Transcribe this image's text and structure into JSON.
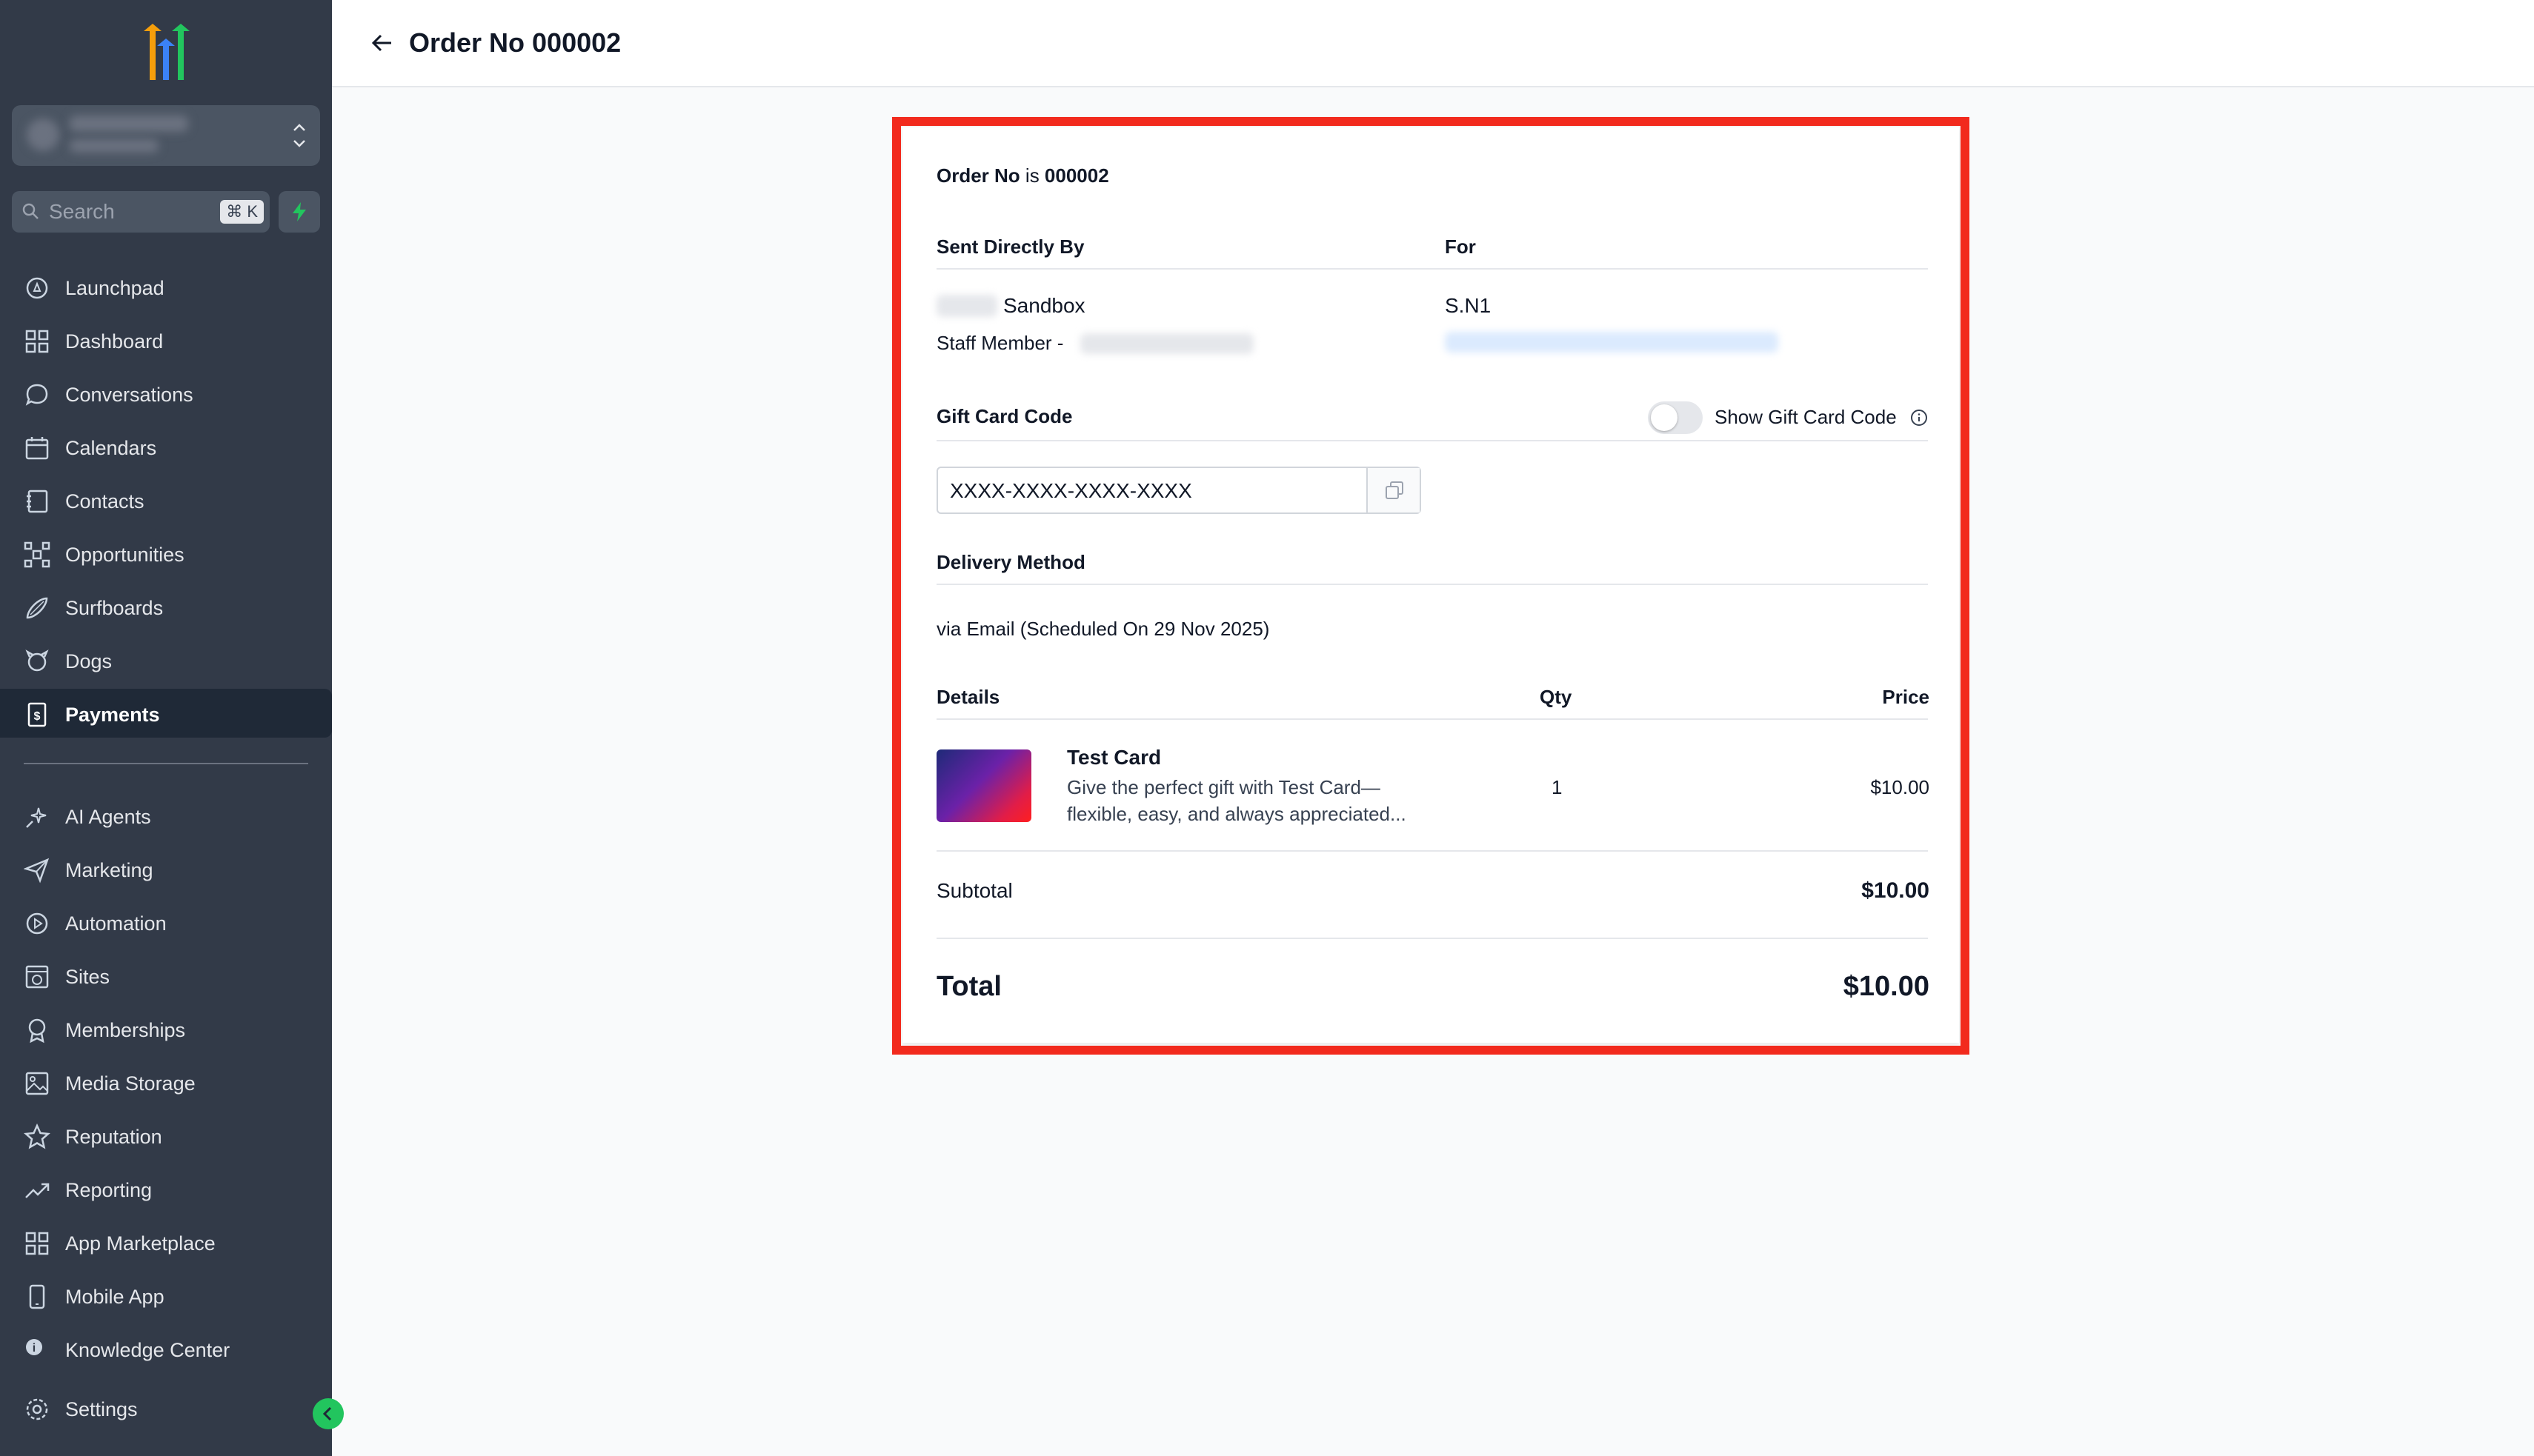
{
  "sidebar": {
    "search_placeholder": "Search",
    "search_shortcut": "⌘ K",
    "items": [
      {
        "label": "Launchpad",
        "icon": "rocket-icon"
      },
      {
        "label": "Dashboard",
        "icon": "grid-icon"
      },
      {
        "label": "Conversations",
        "icon": "chat-icon"
      },
      {
        "label": "Calendars",
        "icon": "calendar-icon"
      },
      {
        "label": "Contacts",
        "icon": "contacts-icon"
      },
      {
        "label": "Opportunities",
        "icon": "network-icon"
      },
      {
        "label": "Surfboards",
        "icon": "surfboard-icon"
      },
      {
        "label": "Dogs",
        "icon": "dog-icon"
      },
      {
        "label": "Payments",
        "icon": "receipt-icon",
        "active": true
      },
      {
        "label": "AI Agents",
        "icon": "sparkle-icon"
      },
      {
        "label": "Marketing",
        "icon": "send-icon"
      },
      {
        "label": "Automation",
        "icon": "automation-icon"
      },
      {
        "label": "Sites",
        "icon": "globe-window-icon"
      },
      {
        "label": "Memberships",
        "icon": "award-icon"
      },
      {
        "label": "Media Storage",
        "icon": "image-icon"
      },
      {
        "label": "Reputation",
        "icon": "star-icon"
      },
      {
        "label": "Reporting",
        "icon": "trend-icon"
      },
      {
        "label": "App Marketplace",
        "icon": "apps-icon"
      },
      {
        "label": "Mobile App",
        "icon": "phone-icon"
      },
      {
        "label": "Knowledge Center",
        "icon": "info-circle-icon"
      }
    ],
    "settings_label": "Settings",
    "brand_colors": [
      "#f59e0b",
      "#3b82f6",
      "#22c55e"
    ]
  },
  "header": {
    "title": "Order No 000002"
  },
  "order": {
    "order_no_label": "Order No",
    "order_no_is": " is ",
    "order_no_value": "000002",
    "sent_by_label": "Sent Directly By",
    "for_label": "For",
    "sender_name": "Sandbox",
    "staff_member_label": "Staff Member -",
    "recipient_name": "S.N1",
    "gift_card_code_label": "Gift Card Code",
    "show_code_label": "Show Gift Card Code",
    "show_code_enabled": false,
    "code_value": "XXXX-XXXX-XXXX-XXXX",
    "delivery_method_label": "Delivery Method",
    "delivery_method_value": "via Email (Scheduled On 29 Nov 2025)",
    "details_header": "Details",
    "qty_header": "Qty",
    "price_header": "Price",
    "item": {
      "name": "Test Card",
      "description_line1": "Give the perfect gift with Test Card—",
      "description_line2": "flexible, easy, and always appreciated...",
      "qty": "1",
      "price": "$10.00"
    },
    "subtotal_label": "Subtotal",
    "subtotal_value": "$10.00",
    "total_label": "Total",
    "total_value": "$10.00"
  },
  "colors": {
    "highlight": "#f22a1d",
    "sidebar_bg": "#323a48",
    "accent_green": "#22c55e"
  }
}
